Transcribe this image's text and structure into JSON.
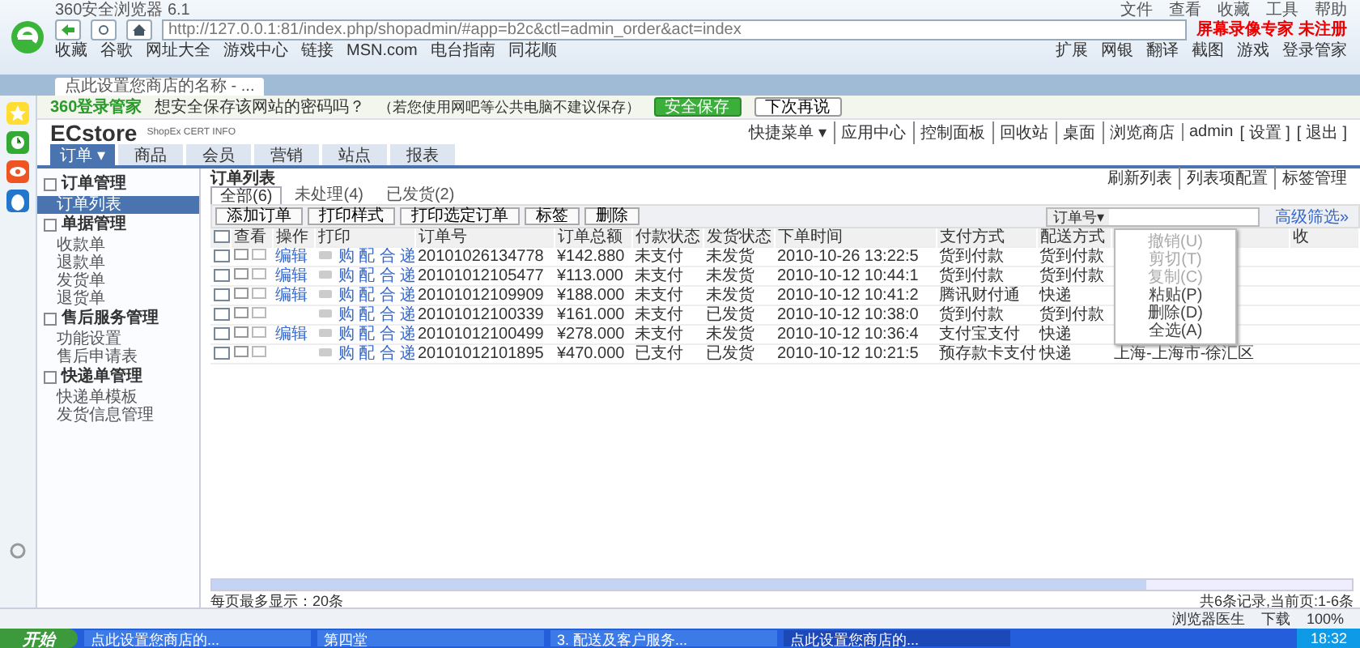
{
  "window": {
    "title": "360安全浏览器 6.1"
  },
  "menu_bar": [
    "文件",
    "查看",
    "收藏",
    "工具",
    "帮助"
  ],
  "address_bar": {
    "url": "http://127.0.0.1:81/index.php/shopadmin/#app=b2c&ctl=admin_order&act=index",
    "watermark_text": "屏幕录像专家  未注册"
  },
  "bookmarks": [
    "收藏",
    "谷歌",
    "网址大全",
    "游戏中心",
    "链接",
    "MSN.com",
    "电台指南",
    "同花顺"
  ],
  "toolbar_right": [
    "扩展",
    "网银",
    "翻译",
    "截图",
    "游戏",
    "登录管家"
  ],
  "browser_tabs": [
    {
      "label": "点此设置您商店的名称 - ...",
      "selected": true
    }
  ],
  "password_bar": {
    "brand": "360登录管家",
    "question": "想安全保存该网站的密码吗？",
    "note": "（若您使用网吧等公共电脑不建议保存）",
    "buttons": [
      "安全保存",
      "下次再说"
    ]
  },
  "header": {
    "logo": "ECstore",
    "sub": "ShopEx CERT INFO",
    "links": [
      "快捷菜单 ▾",
      "应用中心",
      "控制面板",
      "回收站",
      "桌面",
      "浏览商店"
    ],
    "user": "admin",
    "user_links": [
      "[ 设置 ]",
      "[ 退出 ]"
    ]
  },
  "nav_tabs": [
    {
      "label": "订单 ▾",
      "selected": true
    },
    {
      "label": "商品",
      "selected": false
    },
    {
      "label": "会员",
      "selected": false
    },
    {
      "label": "营销",
      "selected": false
    },
    {
      "label": "站点",
      "selected": false
    },
    {
      "label": "报表",
      "selected": false
    }
  ],
  "sidebar": [
    {
      "title": "订单管理",
      "items": [
        {
          "label": "订单列表",
          "selected": true
        }
      ]
    },
    {
      "title": "单据管理",
      "items": [
        {
          "label": "收款单",
          "selected": false
        },
        {
          "label": "退款单",
          "selected": false
        },
        {
          "label": "发货单",
          "selected": false
        },
        {
          "label": "退货单",
          "selected": false
        }
      ]
    },
    {
      "title": "售后服务管理",
      "items": [
        {
          "label": "功能设置",
          "selected": false
        },
        {
          "label": "售后申请表",
          "selected": false
        }
      ]
    },
    {
      "title": "快递单管理",
      "items": [
        {
          "label": "快递单模板",
          "selected": false
        },
        {
          "label": "发货信息管理",
          "selected": false
        }
      ]
    }
  ],
  "content": {
    "title": "订单列表",
    "links": [
      "刷新列表",
      "列表项配置",
      "标签管理"
    ],
    "filter_tabs": [
      {
        "label": "全部(6)",
        "selected": true
      },
      {
        "label": "未处理(4)",
        "selected": false
      },
      {
        "label": "已发货(2)",
        "selected": false
      }
    ],
    "actions": [
      "添加订单",
      "打印样式",
      "打印选定订单",
      "标签",
      "删除"
    ],
    "search": {
      "field": "订单号▾",
      "advanced": "高级筛选»"
    }
  },
  "table": {
    "select_all_checked": false,
    "columns": [
      "查看",
      "操作",
      "打印",
      "订单号",
      "订单总额",
      "付款状态",
      "发货状态",
      "下单时间",
      "支付方式",
      "配送方式",
      "收"
    ],
    "rows": [
      {
        "checked": false,
        "edit": "编辑",
        "print": "购 配 合 递",
        "order_no": "20101026134778",
        "total": "¥142.880",
        "pay_status": "未支付",
        "ship_status": "未发货",
        "time": "2010-10-26 13:22:5",
        "payment": "货到付款",
        "delivery": "货到付款"
      },
      {
        "checked": false,
        "edit": "编辑",
        "print": "购 配 合 递",
        "order_no": "20101012105477",
        "total": "¥113.000",
        "pay_status": "未支付",
        "ship_status": "未发货",
        "time": "2010-10-12 10:44:1",
        "payment": "货到付款",
        "delivery": "货到付款"
      },
      {
        "checked": false,
        "edit": "编辑",
        "print": "购 配 合 递",
        "order_no": "20101012109909",
        "total": "¥188.000",
        "pay_status": "未支付",
        "ship_status": "未发货",
        "time": "2010-10-12 10:41:2",
        "payment": "腾讯财付通",
        "delivery": "快递"
      },
      {
        "checked": false,
        "print": "购 配 合 递",
        "order_no": "20101012100339",
        "total": "¥161.000",
        "pay_status": "未支付",
        "ship_status": "已发货",
        "time": "2010-10-12 10:38:0",
        "payment": "货到付款",
        "delivery": "货到付款"
      },
      {
        "checked": false,
        "edit": "编辑",
        "print": "购 配 合 递",
        "order_no": "20101012100499",
        "total": "¥278.000",
        "pay_status": "未支付",
        "ship_status": "未发货",
        "time": "2010-10-12 10:36:4",
        "payment": "支付宝支付",
        "delivery": "快递"
      },
      {
        "checked": false,
        "print": "购 配 合 递",
        "order_no": "20101012101895",
        "total": "¥470.000",
        "pay_status": "已支付",
        "ship_status": "已发货",
        "time": "2010-10-12 10:21:5",
        "payment": "预存款卡支付",
        "delivery": "快递",
        "region": "上海-上海市-徐汇区"
      }
    ]
  },
  "context_menu": [
    {
      "label": "撤销(U)",
      "disabled": true
    },
    {
      "label": "剪切(T)",
      "disabled": true
    },
    {
      "label": "复制(C)",
      "disabled": true
    },
    {
      "label": "粘贴(P)",
      "disabled": false
    },
    {
      "label": "删除(D)",
      "disabled": false
    },
    {
      "label": "全选(A)",
      "disabled": false
    }
  ],
  "footer": {
    "page_size": "每页最多显示：20条",
    "summary": "共6条记录,当前页:1-6条"
  },
  "status_bar": [
    "浏览器医生",
    "下载",
    "100%"
  ],
  "taskbar": {
    "start": "开始",
    "items": [
      {
        "label": "点此设置您商店的...",
        "selected": false
      },
      {
        "label": "第四堂",
        "selected": false
      },
      {
        "label": "3. 配送及客户服务...",
        "selected": false
      },
      {
        "label": "点此设置您商店的...",
        "selected": true
      }
    ],
    "clock": "18:32"
  }
}
